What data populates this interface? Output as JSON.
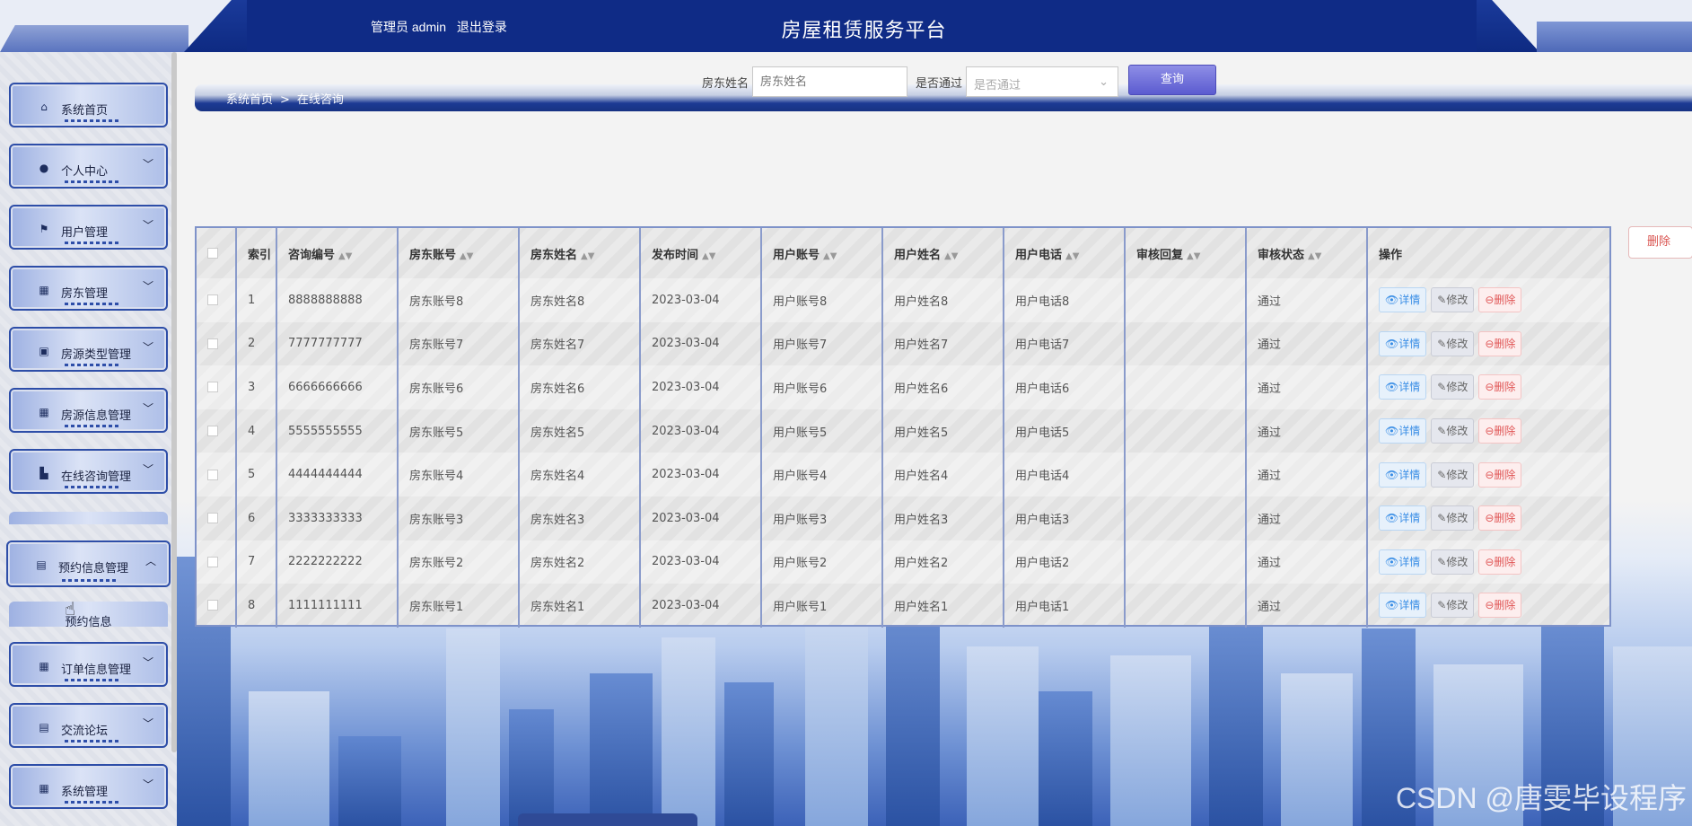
{
  "header": {
    "user_label": "管理员 admin",
    "logout_label": "退出登录",
    "app_title": "房屋租赁服务平台"
  },
  "sidebar": {
    "items": [
      {
        "label": "系统首页",
        "icon": "home-icon",
        "glyph": "⌂"
      },
      {
        "label": "个人中心",
        "icon": "person-icon",
        "glyph": "●"
      },
      {
        "label": "用户管理",
        "icon": "flag-icon",
        "glyph": "⚑"
      },
      {
        "label": "房东管理",
        "icon": "grid-icon",
        "glyph": "▦"
      },
      {
        "label": "房源类型管理",
        "icon": "chart-icon",
        "glyph": "▣"
      },
      {
        "label": "房源信息管理",
        "icon": "grid-icon",
        "glyph": "▦"
      },
      {
        "label": "在线咨询管理",
        "icon": "chat-icon",
        "glyph": "▙"
      },
      {
        "label": "预约信息管理",
        "icon": "clipboard-icon",
        "glyph": "▤"
      },
      {
        "label": "订单信息管理",
        "icon": "grid-icon",
        "glyph": "▦"
      },
      {
        "label": "交流论坛",
        "icon": "clipboard-icon",
        "glyph": "▤"
      },
      {
        "label": "系统管理",
        "icon": "grid-icon",
        "glyph": "▦"
      }
    ],
    "submenu_label": "预约信息"
  },
  "breadcrumb": {
    "home": "系统首页",
    "separator": ">",
    "current": "在线咨询"
  },
  "search": {
    "landlord_name_label": "房东姓名",
    "landlord_name_placeholder": "房东姓名",
    "approved_label": "是否通过",
    "approved_placeholder": "是否通过",
    "query_label": "查询"
  },
  "delete_button_label": "删除",
  "table": {
    "columns": [
      "索引",
      "咨询编号",
      "房东账号",
      "房东姓名",
      "发布时间",
      "用户账号",
      "用户姓名",
      "用户电话",
      "审核回复",
      "审核状态",
      "操作"
    ],
    "rows": [
      {
        "idx": "1",
        "id": "8888888888",
        "landlord_acct": "房东账号8",
        "landlord_name": "房东姓名8",
        "time": "2023-03-04",
        "user_acct": "用户账号8",
        "user_name": "用户姓名8",
        "user_phone": "用户电话8",
        "reply": "",
        "status": "通过"
      },
      {
        "idx": "2",
        "id": "7777777777",
        "landlord_acct": "房东账号7",
        "landlord_name": "房东姓名7",
        "time": "2023-03-04",
        "user_acct": "用户账号7",
        "user_name": "用户姓名7",
        "user_phone": "用户电话7",
        "reply": "",
        "status": "通过"
      },
      {
        "idx": "3",
        "id": "6666666666",
        "landlord_acct": "房东账号6",
        "landlord_name": "房东姓名6",
        "time": "2023-03-04",
        "user_acct": "用户账号6",
        "user_name": "用户姓名6",
        "user_phone": "用户电话6",
        "reply": "",
        "status": "通过"
      },
      {
        "idx": "4",
        "id": "5555555555",
        "landlord_acct": "房东账号5",
        "landlord_name": "房东姓名5",
        "time": "2023-03-04",
        "user_acct": "用户账号5",
        "user_name": "用户姓名5",
        "user_phone": "用户电话5",
        "reply": "",
        "status": "通过"
      },
      {
        "idx": "5",
        "id": "4444444444",
        "landlord_acct": "房东账号4",
        "landlord_name": "房东姓名4",
        "time": "2023-03-04",
        "user_acct": "用户账号4",
        "user_name": "用户姓名4",
        "user_phone": "用户电话4",
        "reply": "",
        "status": "通过"
      },
      {
        "idx": "6",
        "id": "3333333333",
        "landlord_acct": "房东账号3",
        "landlord_name": "房东姓名3",
        "time": "2023-03-04",
        "user_acct": "用户账号3",
        "user_name": "用户姓名3",
        "user_phone": "用户电话3",
        "reply": "",
        "status": "通过"
      },
      {
        "idx": "7",
        "id": "2222222222",
        "landlord_acct": "房东账号2",
        "landlord_name": "房东姓名2",
        "time": "2023-03-04",
        "user_acct": "用户账号2",
        "user_name": "用户姓名2",
        "user_phone": "用户电话2",
        "reply": "",
        "status": "通过"
      },
      {
        "idx": "8",
        "id": "1111111111",
        "landlord_acct": "房东账号1",
        "landlord_name": "房东姓名1",
        "time": "2023-03-04",
        "user_acct": "用户账号1",
        "user_name": "用户姓名1",
        "user_phone": "用户电话1",
        "reply": "",
        "status": "通过"
      }
    ],
    "actions": {
      "detail": "详情",
      "edit": "修改",
      "delete": "删除"
    }
  },
  "watermark": "CSDN @唐雯毕设程序"
}
